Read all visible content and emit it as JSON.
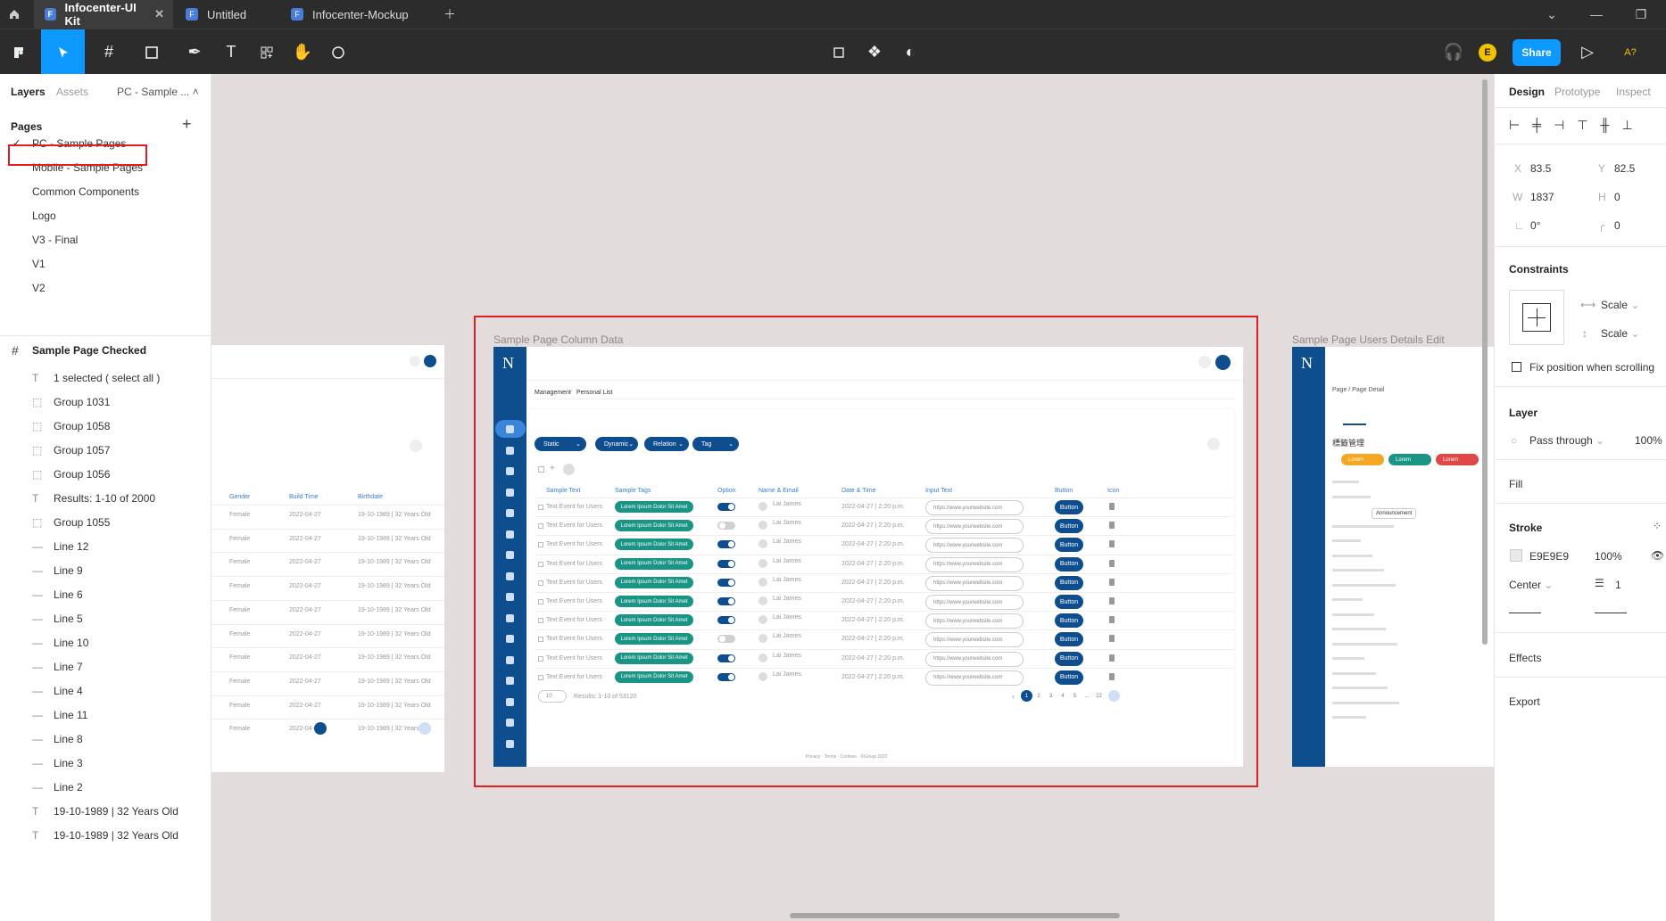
{
  "tabs": [
    {
      "label": "Infocenter-UI Kit",
      "active": true
    },
    {
      "label": "Untitled",
      "active": false
    },
    {
      "label": "Infocenter-Mockup",
      "active": false
    }
  ],
  "toolbar": {
    "share_label": "Share",
    "avatar": "E",
    "zoom_label": "A?"
  },
  "left": {
    "tab_layers": "Layers",
    "tab_assets": "Assets",
    "page_dropdown": "PC - Sample ...",
    "pages_title": "Pages",
    "pages": [
      "PC - Sample Pages",
      "Mobile - Sample Pages",
      "Common Components",
      "Logo",
      "V3 - Final",
      "V1",
      "V2"
    ],
    "frame_layer": "Sample Page Checked",
    "layers": [
      {
        "icon": "T",
        "name": "1 selected ( select all )"
      },
      {
        "icon": "group",
        "name": "Group 1031"
      },
      {
        "icon": "group",
        "name": "Group 1058"
      },
      {
        "icon": "group",
        "name": "Group 1057"
      },
      {
        "icon": "group",
        "name": "Group 1056"
      },
      {
        "icon": "T",
        "name": "Results: 1-10 of 2000"
      },
      {
        "icon": "group",
        "name": "Group 1055"
      },
      {
        "icon": "line",
        "name": "Line 12"
      },
      {
        "icon": "line",
        "name": "Line 9"
      },
      {
        "icon": "line",
        "name": "Line 6"
      },
      {
        "icon": "line",
        "name": "Line 5"
      },
      {
        "icon": "line",
        "name": "Line 10"
      },
      {
        "icon": "line",
        "name": "Line 7"
      },
      {
        "icon": "line",
        "name": "Line 4"
      },
      {
        "icon": "line",
        "name": "Line 11"
      },
      {
        "icon": "line",
        "name": "Line 8"
      },
      {
        "icon": "line",
        "name": "Line 3"
      },
      {
        "icon": "line",
        "name": "Line 2"
      },
      {
        "icon": "T",
        "name": "19-10-1989 | 32 Years Old"
      },
      {
        "icon": "T",
        "name": "19-10-1989 | 32 Years Old"
      }
    ]
  },
  "right": {
    "tab_design": "Design",
    "tab_prototype": "Prototype",
    "tab_inspect": "Inspect",
    "x_label": "X",
    "x": "83.5",
    "y_label": "Y",
    "y": "82.5",
    "w_label": "W",
    "w": "1837",
    "h_label": "H",
    "h": "0",
    "rot": "0°",
    "radius": "0",
    "constraints_title": "Constraints",
    "scale_h": "Scale",
    "scale_v": "Scale",
    "fix_position": "Fix position when scrolling",
    "layer_title": "Layer",
    "blend": "Pass through",
    "opacity": "100%",
    "fill_title": "Fill",
    "stroke_title": "Stroke",
    "stroke_color": "E9E9E9",
    "stroke_opacity": "100%",
    "stroke_align": "Center",
    "stroke_weight": "1",
    "effects_title": "Effects",
    "export_title": "Export"
  },
  "canvas": {
    "frame_main_label": "Sample Page Column Data",
    "frame_right_label": "Sample Page Users Details Edit",
    "breadcrumb_1": "Management",
    "breadcrumb_2": "Personal List",
    "filters": [
      "Static",
      "Dynamic",
      "Relation",
      "Tag"
    ],
    "headers": [
      "Sample Text",
      "Sample Tags",
      "Option",
      "Name & Email",
      "Date & Time",
      "Input Text",
      "Button",
      "Icon"
    ],
    "row_text": "Text Event for Users",
    "row_tag": "Lorem Ipsum Dolor Sit Amet",
    "row_name": "Lai James",
    "row_date": "2022-04-27 | 2:20 p.m.",
    "row_input": "https://www.yourwebsite.com",
    "row_button": "Button",
    "toggles": [
      true,
      false,
      true,
      true,
      true,
      true,
      true,
      false,
      true,
      true
    ],
    "results": "Results: 1-10 of 53120",
    "per_page": "10",
    "pagination": [
      "1",
      "2",
      "3",
      "4",
      "5",
      "...",
      "22"
    ],
    "footer": "Privacy · Terms · Cookies · ©Group 2022",
    "left_headers": [
      "Gender",
      "Build Time",
      "Birthdate"
    ],
    "left_gender": "Female",
    "left_date": "2022-04-27",
    "left_birth": "19-10-1989 | 32 Years Old",
    "right_breadcrumb": "Page  /  Page Detail",
    "right_heading": "標籤管理",
    "right_chips": [
      "Lorem",
      "Lorem",
      "Lorem"
    ],
    "right_announcement": "Announcement",
    "accent": "#0e4e8e",
    "tag_color": "#1a9484",
    "selection_color": "#e02020",
    "figma_blue": "#0d99ff"
  }
}
